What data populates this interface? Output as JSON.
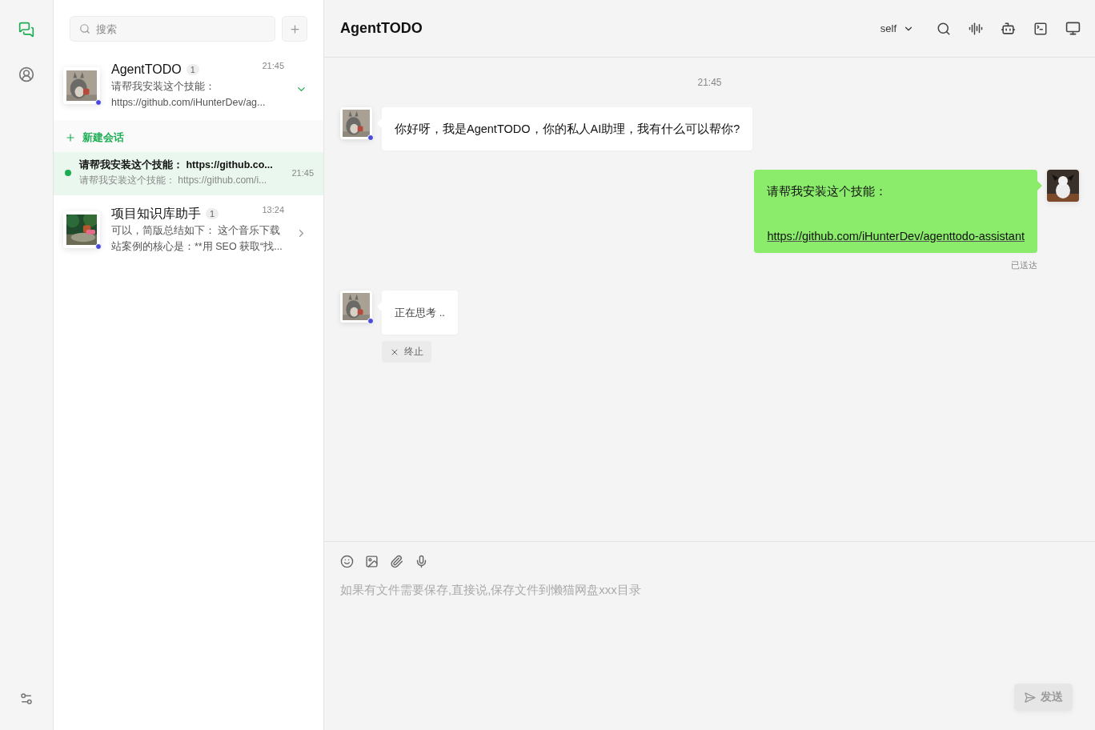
{
  "rail": {
    "items": [
      {
        "kind": "chats",
        "selected": true
      },
      {
        "kind": "contacts",
        "selected": false
      }
    ]
  },
  "search": {
    "placeholder": "搜索"
  },
  "agents": [
    {
      "name": "AgentTODO",
      "badge": "1",
      "time": "21:45",
      "preview_lines": [
        "请帮我安装这个技能：",
        "https://github.com/iHunterDev/ag..."
      ],
      "expanded": true,
      "new_session": "新建会话",
      "sessions": [
        {
          "title": "请帮我安装这个技能： https://github.co...",
          "preview": "请帮我安装这个技能： https://github.com/i...",
          "time": "21:45",
          "selected": true
        }
      ]
    },
    {
      "name": "项目知识库助手",
      "badge": "1",
      "time": "13:24",
      "preview_lines": [
        "可以，简版总结如下： 这个音乐下载",
        "站案例的核心是：**用 SEO 获取“找..."
      ],
      "expanded": false
    }
  ],
  "chat": {
    "title": "AgentTODO",
    "selector": "self"
  },
  "messages": [
    {
      "kind": "time",
      "text": "21:45"
    },
    {
      "kind": "agent",
      "text": "你好呀，我是AgentTODO，你的私人AI助理，我有什么可以帮你?"
    },
    {
      "kind": "user",
      "lines": [
        "请帮我安装这个技能："
      ],
      "link": "https://github.com/iHunterDev/agenttodo-assistant",
      "status": "已送达"
    },
    {
      "kind": "thinking",
      "text": "正在思考",
      "dots": "..",
      "stop": "终止"
    }
  ],
  "composer": {
    "placeholder": "如果有文件需要保存,直接说,保存文件到懒猫网盘xxx目录",
    "send": "发送",
    "send_disabled": true
  }
}
